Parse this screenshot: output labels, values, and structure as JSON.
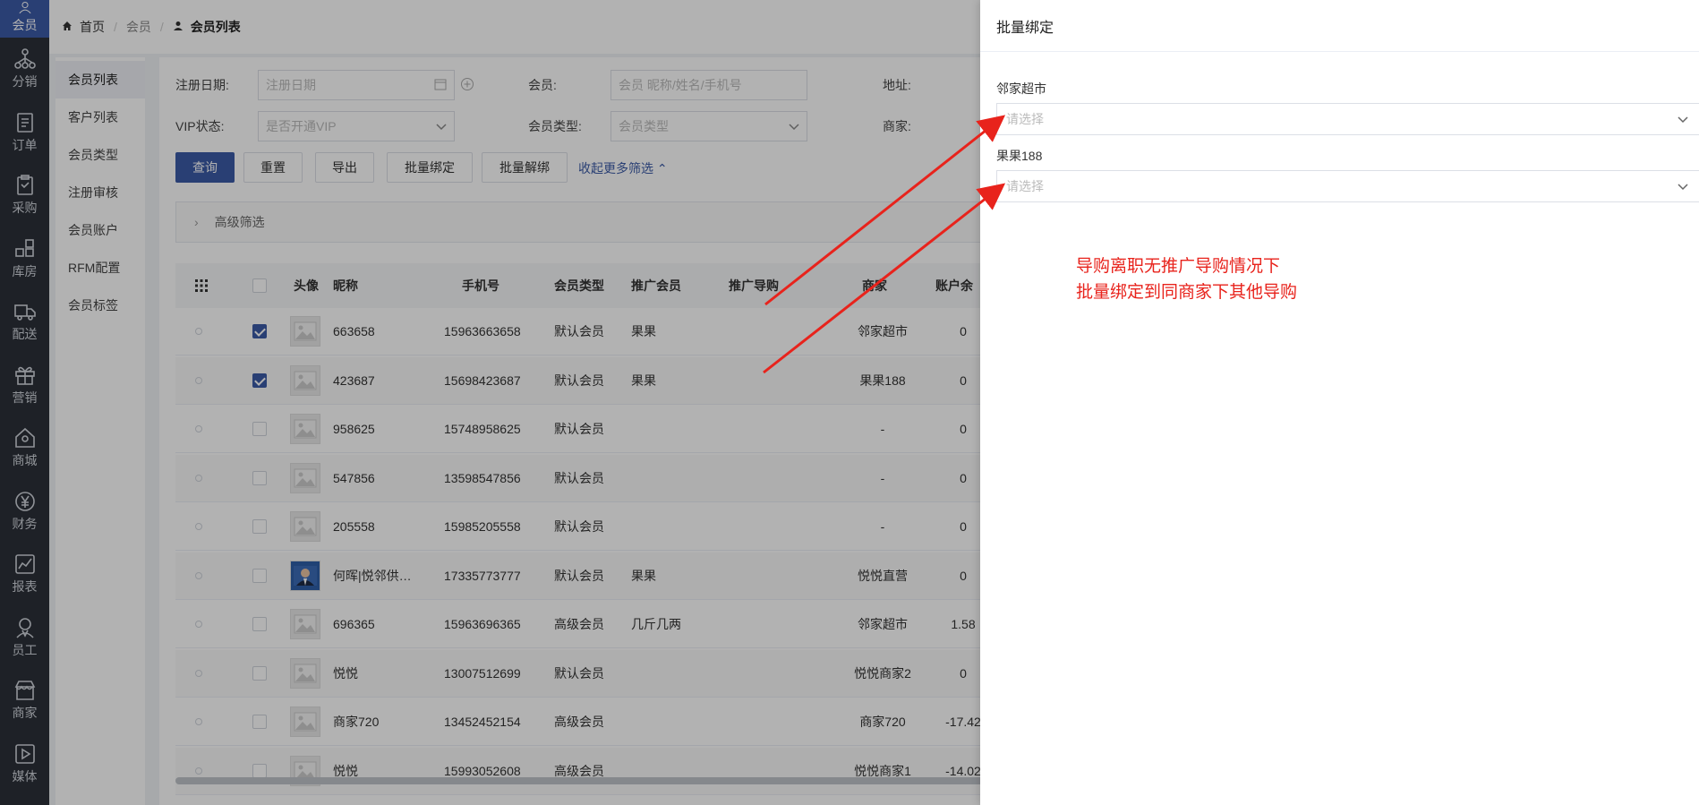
{
  "nav": [
    {
      "label": "会员",
      "icon": "member-icon",
      "active": true
    },
    {
      "label": "分销",
      "icon": "distribution-icon"
    },
    {
      "label": "订单",
      "icon": "order-icon"
    },
    {
      "label": "采购",
      "icon": "purchase-icon"
    },
    {
      "label": "库房",
      "icon": "warehouse-icon"
    },
    {
      "label": "配送",
      "icon": "truck-icon"
    },
    {
      "label": "营销",
      "icon": "gift-icon"
    },
    {
      "label": "商城",
      "icon": "shop-icon"
    },
    {
      "label": "财务",
      "icon": "yen-icon"
    },
    {
      "label": "报表",
      "icon": "chart-icon"
    },
    {
      "label": "员工",
      "icon": "staff-icon"
    },
    {
      "label": "商家",
      "icon": "store-icon"
    },
    {
      "label": "媒体",
      "icon": "media-icon"
    }
  ],
  "breadcrumb": {
    "home": "首页",
    "section": "会员",
    "current": "会员列表"
  },
  "submenu": [
    "会员列表",
    "客户列表",
    "会员类型",
    "注册审核",
    "会员账户",
    "RFM配置",
    "会员标签"
  ],
  "filters": {
    "reg_date_label": "注册日期:",
    "reg_date_placeholder": "注册日期",
    "member_label": "会员:",
    "member_placeholder": "会员 昵称/姓名/手机号",
    "address_label": "地址:",
    "vip_label": "VIP状态:",
    "vip_placeholder": "是否开通VIP",
    "member_type_label": "会员类型:",
    "member_type_placeholder": "会员类型",
    "merchant_label": "商家:"
  },
  "buttons": {
    "query": "查询",
    "reset": "重置",
    "export": "导出",
    "batch_bind": "批量绑定",
    "batch_unbind": "批量解绑",
    "collapse": "收起更多筛选"
  },
  "advanced": "高级筛选",
  "columns": {
    "avatar": "头像",
    "nickname": "昵称",
    "phone": "手机号",
    "type": "会员类型",
    "promoter": "推广会员",
    "guide": "推广导购",
    "merchant": "商家",
    "balance": "账户余"
  },
  "rows": [
    {
      "checked": true,
      "photo": false,
      "nickname": "663658",
      "phone": "15963663658",
      "type": "默认会员",
      "promoter": "果果",
      "merchant": "邻家超市",
      "balance": "0"
    },
    {
      "checked": true,
      "photo": false,
      "nickname": "423687",
      "phone": "15698423687",
      "type": "默认会员",
      "promoter": "果果",
      "merchant": "果果188",
      "balance": "0"
    },
    {
      "checked": false,
      "photo": false,
      "nickname": "958625",
      "phone": "15748958625",
      "type": "默认会员",
      "promoter": "",
      "merchant": "-",
      "balance": "0"
    },
    {
      "checked": false,
      "photo": false,
      "nickname": "547856",
      "phone": "13598547856",
      "type": "默认会员",
      "promoter": "",
      "merchant": "-",
      "balance": "0"
    },
    {
      "checked": false,
      "photo": false,
      "nickname": "205558",
      "phone": "15985205558",
      "type": "默认会员",
      "promoter": "",
      "merchant": "-",
      "balance": "0"
    },
    {
      "checked": false,
      "photo": true,
      "nickname": "何晖|悦邻供…",
      "phone": "17335773777",
      "type": "默认会员",
      "promoter": "果果",
      "merchant": "悦悦直营",
      "balance": "0"
    },
    {
      "checked": false,
      "photo": false,
      "nickname": "696365",
      "phone": "15963696365",
      "type": "高级会员",
      "promoter": "几斤几两",
      "merchant": "邻家超市",
      "balance": "1.58"
    },
    {
      "checked": false,
      "photo": false,
      "nickname": "悦悦",
      "phone": "13007512699",
      "type": "默认会员",
      "promoter": "",
      "merchant": "悦悦商家2",
      "balance": "0"
    },
    {
      "checked": false,
      "photo": false,
      "nickname": "商家720",
      "phone": "13452452154",
      "type": "高级会员",
      "promoter": "",
      "merchant": "商家720",
      "balance": "-17.42"
    },
    {
      "checked": false,
      "photo": false,
      "nickname": "悦悦",
      "phone": "15993052608",
      "type": "高级会员",
      "promoter": "",
      "merchant": "悦悦商家1",
      "balance": "-14.02"
    }
  ],
  "drawer": {
    "title": "批量绑定",
    "groups": [
      {
        "label": "邻家超市",
        "placeholder": "请选择"
      },
      {
        "label": "果果188",
        "placeholder": "请选择"
      }
    ]
  },
  "annotation": {
    "line1": "导购离职无推广导购情况下",
    "line2": "批量绑定到同商家下其他导购",
    "color": "#e8231c"
  },
  "colors": {
    "accent": "#3c5ba6",
    "rail": "#2b3038"
  }
}
